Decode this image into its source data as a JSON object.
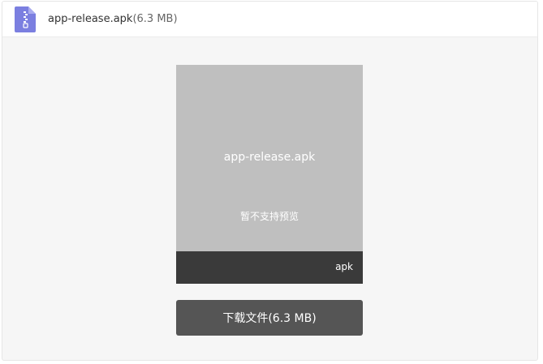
{
  "header": {
    "file_icon": "zip-file-icon",
    "file_name": "app-release.apk",
    "file_size": "(6.3 MB)"
  },
  "preview": {
    "file_name": "app-release.apk",
    "message": "暂不支持预览",
    "extension": "apk"
  },
  "download_button": {
    "label": "下载文件(6.3 MB)"
  },
  "colors": {
    "icon_accent": "#7b7fe0",
    "preview_bg": "#bfbfbf",
    "preview_footer": "#3a3a3a",
    "button_bg": "#555555",
    "page_bg": "#f6f6f6"
  }
}
